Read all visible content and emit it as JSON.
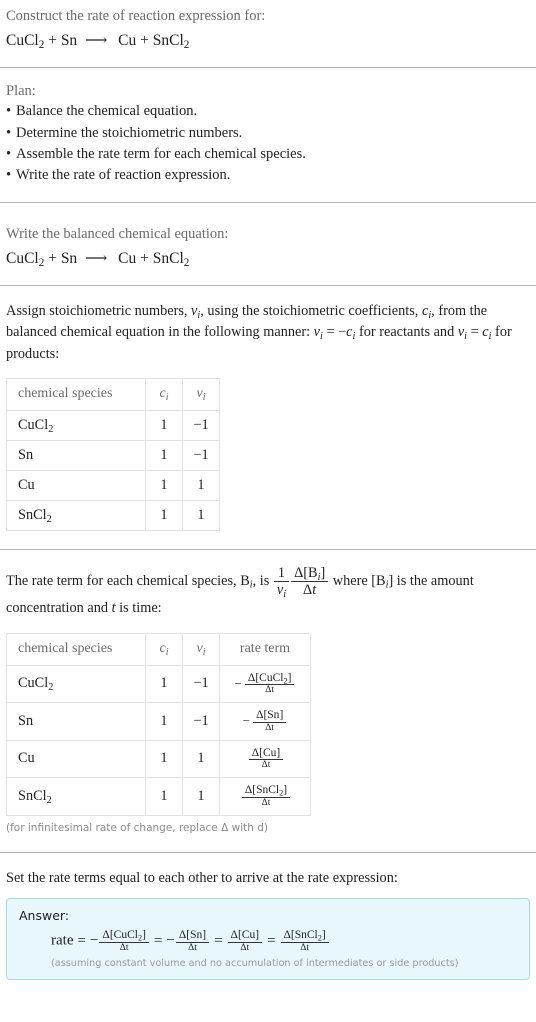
{
  "problem": {
    "prompt": "Construct the rate of reaction expression for:",
    "equation": {
      "reactant1": "CuCl",
      "reactant1_sub": "2",
      "plus1": "+",
      "reactant2": "Sn",
      "arrow": "⟶",
      "product1": "Cu",
      "plus2": "+",
      "product2": "SnCl",
      "product2_sub": "2"
    }
  },
  "plan": {
    "label": "Plan:",
    "steps": [
      "Balance the chemical equation.",
      "Determine the stoichiometric numbers.",
      "Assemble the rate term for each chemical species.",
      "Write the rate of reaction expression."
    ]
  },
  "balanced": {
    "prompt": "Write the balanced chemical equation:",
    "equation": {
      "reactant1": "CuCl",
      "reactant1_sub": "2",
      "plus1": "+",
      "reactant2": "Sn",
      "arrow": "⟶",
      "product1": "Cu",
      "plus2": "+",
      "product2": "SnCl",
      "product2_sub": "2"
    }
  },
  "stoich": {
    "text_1": "Assign stoichiometric numbers, ",
    "sym_nu": "ν",
    "sub_i": "i",
    "text_2": ", using the stoichiometric coefficients, ",
    "sym_c": "c",
    "text_3": ", from the balanced chemical equation in the following manner: ",
    "rule_reactants": "= −",
    "text_4": " for reactants and ",
    "rule_products": "=",
    "text_5": " for products:",
    "table": {
      "headers": [
        "chemical species",
        "c",
        "ν"
      ],
      "header_sub": "i",
      "rows": [
        {
          "species": "CuCl",
          "species_sub": "2",
          "c": "1",
          "nu": "−1"
        },
        {
          "species": "Sn",
          "species_sub": "",
          "c": "1",
          "nu": "−1"
        },
        {
          "species": "Cu",
          "species_sub": "",
          "c": "1",
          "nu": "1"
        },
        {
          "species": "SnCl",
          "species_sub": "2",
          "c": "1",
          "nu": "1"
        }
      ]
    }
  },
  "rateterm": {
    "text_1": "The rate term for each chemical species, ",
    "sym_B": "B",
    "sub_i": "i",
    "text_2": ", is ",
    "frac_outer_num": "1",
    "frac_outer_den": "ν",
    "frac_inner_num": "Δ[B",
    "frac_inner_num_end": "]",
    "frac_inner_den": "Δt",
    "text_3": " where [B",
    "text_4": "] is the amount concentration and ",
    "sym_t": "t",
    "text_5": " is time:",
    "table": {
      "headers": [
        "chemical species",
        "c",
        "ν",
        "rate term"
      ],
      "header_sub": "i",
      "rows": [
        {
          "species": "CuCl",
          "species_sub": "2",
          "c": "1",
          "nu": "−1",
          "sign": "−",
          "num": "Δ[CuCl",
          "num_sub": "2",
          "num_end": "]",
          "den": "Δt"
        },
        {
          "species": "Sn",
          "species_sub": "",
          "c": "1",
          "nu": "−1",
          "sign": "−",
          "num": "Δ[Sn",
          "num_sub": "",
          "num_end": "]",
          "den": "Δt"
        },
        {
          "species": "Cu",
          "species_sub": "",
          "c": "1",
          "nu": "1",
          "sign": "",
          "num": "Δ[Cu",
          "num_sub": "",
          "num_end": "]",
          "den": "Δt"
        },
        {
          "species": "SnCl",
          "species_sub": "2",
          "c": "1",
          "nu": "1",
          "sign": "",
          "num": "Δ[SnCl",
          "num_sub": "2",
          "num_end": "]",
          "den": "Δt"
        }
      ]
    },
    "footnote": "(for infinitesimal rate of change, replace Δ with d)"
  },
  "final": {
    "prompt": "Set the rate terms equal to each other to arrive at the rate expression:",
    "answer_label": "Answer:",
    "rate_word": "rate",
    "equals": "=",
    "terms": [
      {
        "sign": "−",
        "num": "Δ[CuCl",
        "num_sub": "2",
        "num_end": "]",
        "den": "Δt"
      },
      {
        "sign": "−",
        "num": "Δ[Sn",
        "num_sub": "",
        "num_end": "]",
        "den": "Δt"
      },
      {
        "sign": "",
        "num": "Δ[Cu",
        "num_sub": "",
        "num_end": "]",
        "den": "Δt"
      },
      {
        "sign": "",
        "num": "Δ[SnCl",
        "num_sub": "2",
        "num_end": "]",
        "den": "Δt"
      }
    ],
    "note": "(assuming constant volume and no accumulation of intermediates or side products)"
  },
  "colors": {
    "answer_bg": "#e7f7fc",
    "answer_border": "#a9d9e8",
    "rule": "#b5b5b5",
    "table_border": "#e2e2e2",
    "muted_text": "#6b6b6b",
    "body_text": "#222222"
  }
}
